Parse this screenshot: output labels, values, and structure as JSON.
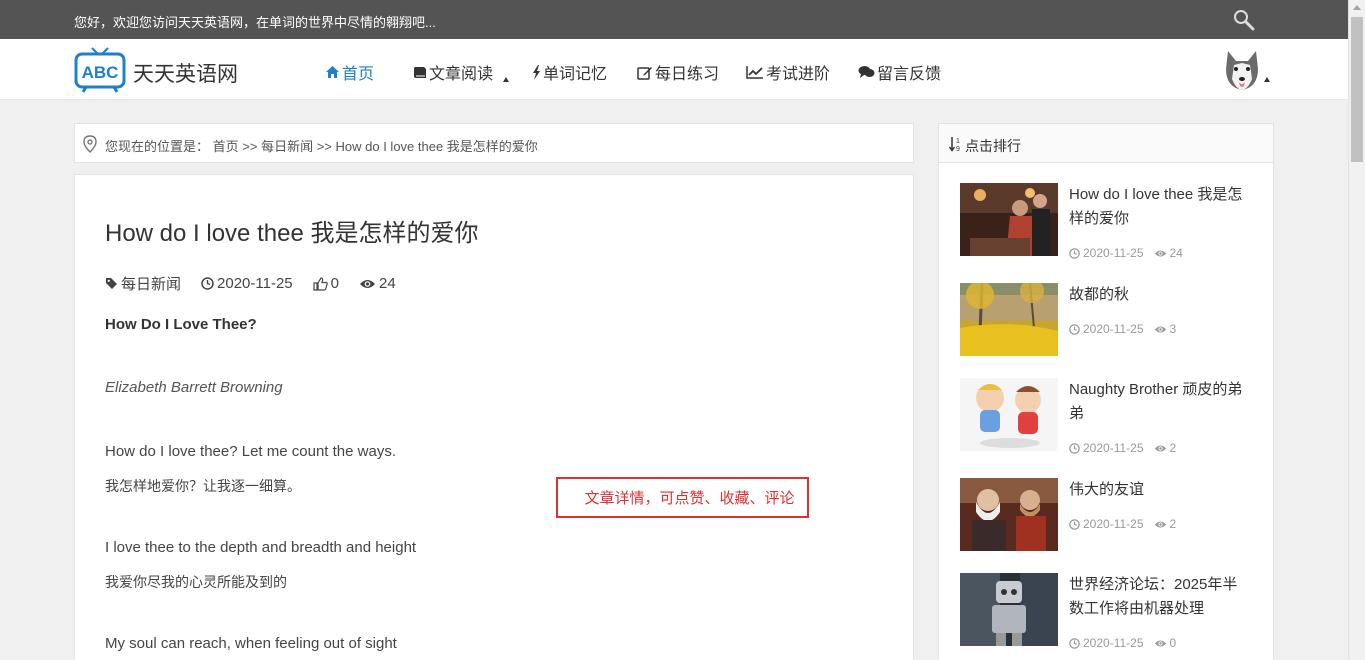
{
  "topbar": {
    "welcome": "您好，欢迎您访问天天英语网，在单词的世界中尽情的翱翔吧..."
  },
  "header": {
    "logo_text": "ABC",
    "site_name": "天天英语网",
    "nav": [
      {
        "label": "首页",
        "icon": "home-icon",
        "active": true
      },
      {
        "label": "文章阅读",
        "icon": "book-icon",
        "active": false
      },
      {
        "label": "单词记忆",
        "icon": "bolt-icon",
        "active": false
      },
      {
        "label": "每日练习",
        "icon": "edit-icon",
        "active": false
      },
      {
        "label": "考试进阶",
        "icon": "line-chart-icon",
        "active": false
      },
      {
        "label": "留言反馈",
        "icon": "comments-icon",
        "active": false
      }
    ]
  },
  "breadcrumb": {
    "prefix": "您现在的位置是：",
    "home": "首页",
    "sep1": " >> ",
    "category": "每日新闻",
    "sep2": " >> ",
    "current": "How do I love thee 我是怎样的爱你"
  },
  "article": {
    "title": "How do I love thee 我是怎样的爱你",
    "meta": {
      "category": "每日新闻",
      "date": "2020-11-25",
      "likes": "0",
      "views": "24"
    },
    "paragraphs": [
      "How Do I Love Thee?",
      "Elizabeth Barrett Browning",
      "How do I love thee? Let me count the ways.",
      "我怎样地爱你？让我逐一细算。",
      "I love thee to the depth and breadth and height",
      "我爱你尽我的心灵所能及到的",
      "My soul can reach, when feeling out of sight"
    ]
  },
  "annotation": "文章详情，可点赞、收藏、评论",
  "sidebar": {
    "title": "点击排行",
    "items": [
      {
        "title": "How do I love thee 我是怎样的爱你",
        "date": "2020-11-25",
        "views": "24"
      },
      {
        "title": "故都的秋",
        "date": "2020-11-25",
        "views": "3"
      },
      {
        "title": "Naughty Brother 顽皮的弟弟",
        "date": "2020-11-25",
        "views": "2"
      },
      {
        "title": "伟大的友谊",
        "date": "2020-11-25",
        "views": "2"
      },
      {
        "title": "世界经济论坛：2025年半数工作将由机器处理",
        "date": "2020-11-25",
        "views": "0"
      }
    ]
  },
  "colors": {
    "accent": "#1E7FCB",
    "topbar": "#545454",
    "annotation": "#e03030"
  }
}
